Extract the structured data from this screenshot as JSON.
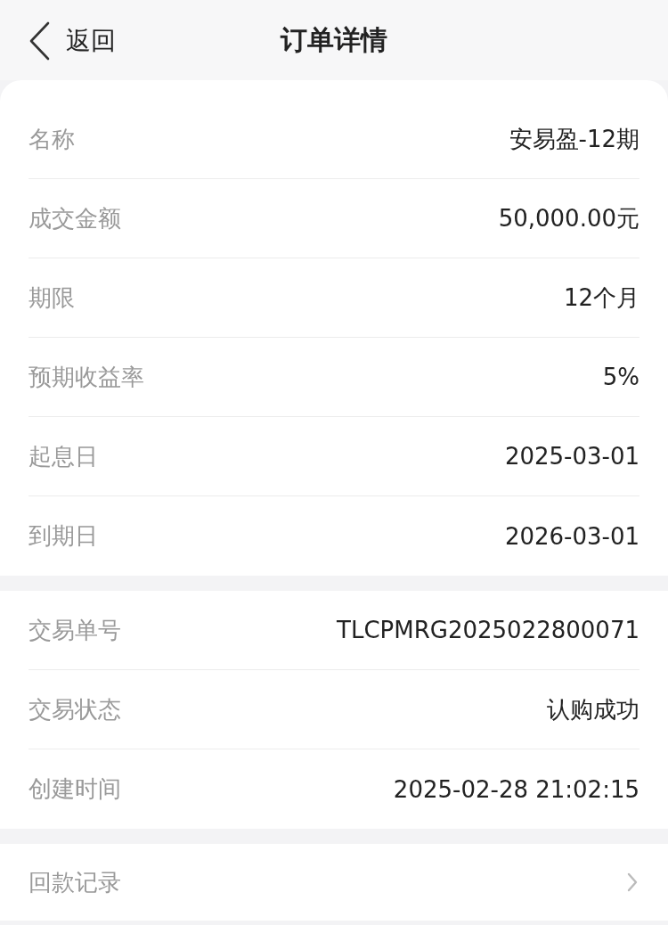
{
  "header": {
    "back_label": "返回",
    "title": "订单详情"
  },
  "sections": [
    {
      "rows": [
        {
          "label": "名称",
          "value": "安易盈-12期"
        },
        {
          "label": "成交金额",
          "value": "50,000.00元"
        },
        {
          "label": "期限",
          "value": "12个月"
        },
        {
          "label": "预期收益率",
          "value": "5%"
        },
        {
          "label": "起息日",
          "value": "2025-03-01"
        },
        {
          "label": "到期日",
          "value": "2026-03-01"
        }
      ]
    },
    {
      "rows": [
        {
          "label": "交易单号",
          "value": "TLCPMRG2025022800071"
        },
        {
          "label": "交易状态",
          "value": "认购成功"
        },
        {
          "label": "创建时间",
          "value": "2025-02-28 21:02:15"
        }
      ]
    }
  ],
  "links": [
    {
      "label": "回款记录"
    }
  ]
}
